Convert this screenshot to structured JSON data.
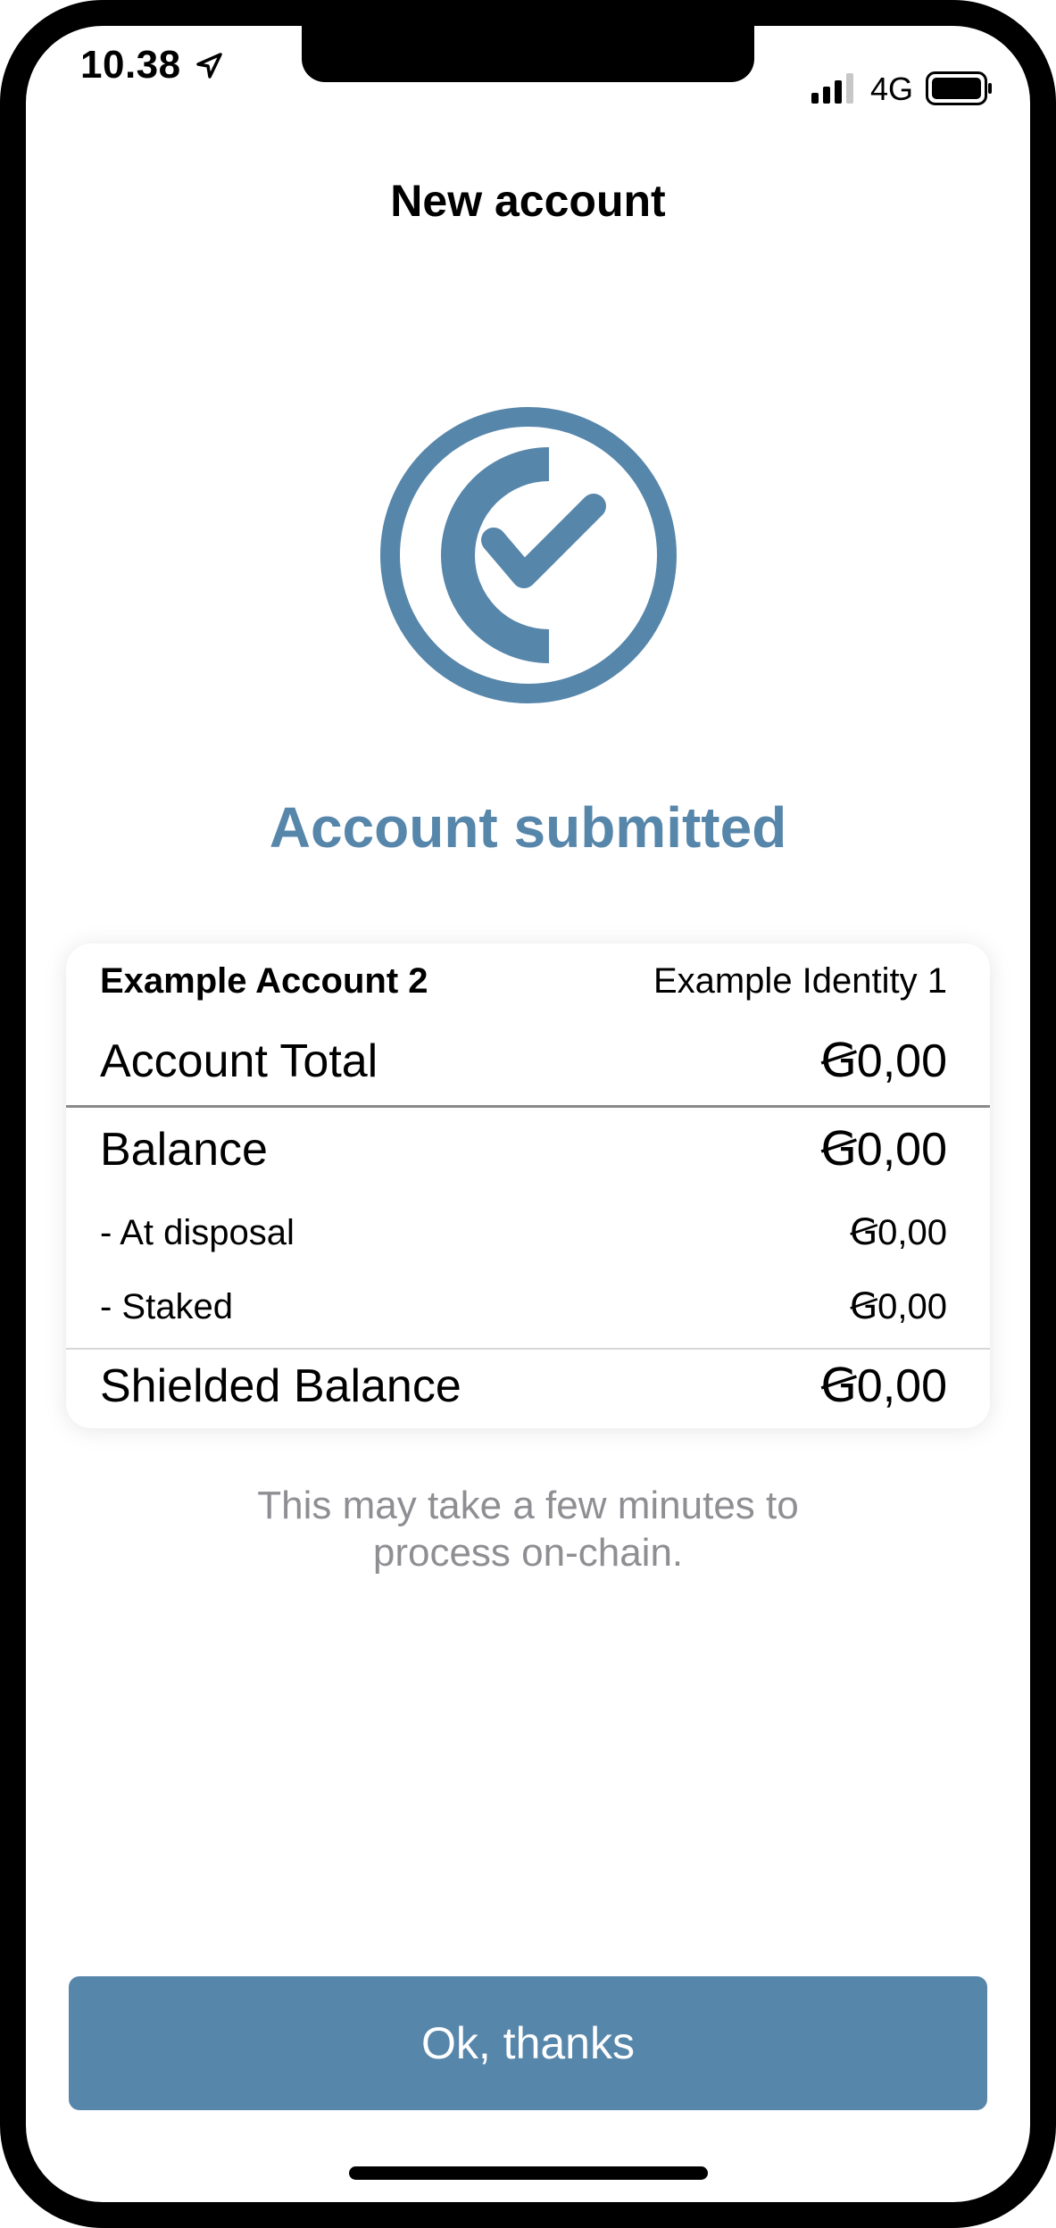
{
  "status_bar": {
    "time": "10.38",
    "network": "4G",
    "icons": [
      "location-arrow-icon",
      "signal-bars-icon",
      "battery-icon"
    ]
  },
  "header": {
    "title": "New account"
  },
  "result": {
    "icon": "check-circle-icon",
    "title": "Account submitted",
    "accent_color": "#5786ab"
  },
  "card": {
    "account_name": "Example Account 2",
    "identity_name": "Example Identity 1",
    "rows": [
      {
        "label": "Account Total",
        "value": "Ꞡ0,00"
      },
      {
        "label": "Balance",
        "value": "Ꞡ0,00"
      },
      {
        "label": "- At disposal",
        "value": "Ꞡ0,00"
      },
      {
        "label": "- Staked",
        "value": "Ꞡ0,00"
      },
      {
        "label": "Shielded Balance",
        "value": "Ꞡ0,00"
      }
    ]
  },
  "note": {
    "line1": "This may take a few minutes to",
    "line2": "process on-chain."
  },
  "primary_button": {
    "label": "Ok, thanks",
    "color": "#5786ab"
  }
}
